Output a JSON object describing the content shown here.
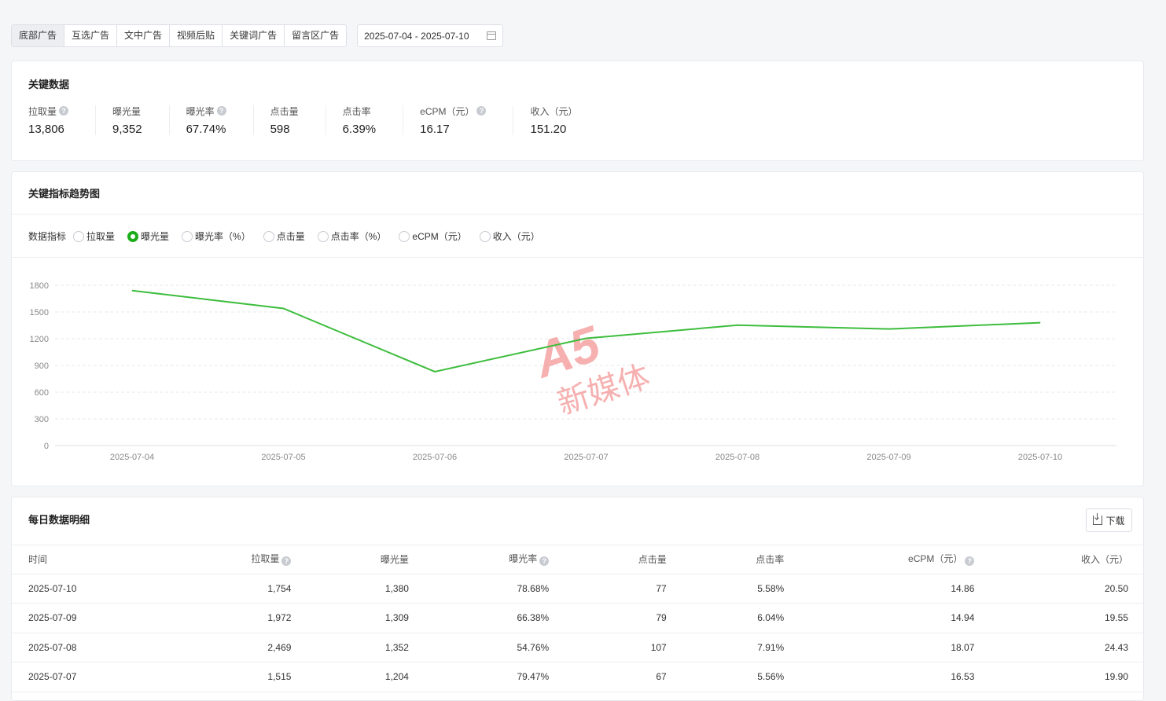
{
  "tabs": [
    {
      "label": "底部广告",
      "active": true
    },
    {
      "label": "互选广告",
      "active": false
    },
    {
      "label": "文中广告",
      "active": false
    },
    {
      "label": "视频后贴",
      "active": false
    },
    {
      "label": "关键词广告",
      "active": false
    },
    {
      "label": "留言区广告",
      "active": false
    }
  ],
  "date_range": "2025-07-04 - 2025-07-10",
  "kpi": {
    "title": "关键数据",
    "items": [
      {
        "label": "拉取量",
        "value": "13,806",
        "help": true
      },
      {
        "label": "曝光量",
        "value": "9,352",
        "help": false
      },
      {
        "label": "曝光率",
        "value": "67.74%",
        "help": true
      },
      {
        "label": "点击量",
        "value": "598",
        "help": false
      },
      {
        "label": "点击率",
        "value": "6.39%",
        "help": false
      },
      {
        "label": "eCPM（元）",
        "value": "16.17",
        "help": true
      },
      {
        "label": "收入（元）",
        "value": "151.20",
        "help": false
      }
    ]
  },
  "trend": {
    "title": "关键指标趋势图",
    "metrics_label": "数据指标",
    "options": [
      {
        "label": "拉取量",
        "checked": false
      },
      {
        "label": "曝光量",
        "checked": true
      },
      {
        "label": "曝光率（%）",
        "checked": false
      },
      {
        "label": "点击量",
        "checked": false
      },
      {
        "label": "点击率（%）",
        "checked": false
      },
      {
        "label": "eCPM（元）",
        "checked": false
      },
      {
        "label": "收入（元）",
        "checked": false
      }
    ],
    "watermark": {
      "logo": "A5",
      "text": "新媒体"
    }
  },
  "chart_data": {
    "type": "line",
    "x": [
      "2025-07-04",
      "2025-07-05",
      "2025-07-06",
      "2025-07-07",
      "2025-07-08",
      "2025-07-09",
      "2025-07-10"
    ],
    "series": [
      {
        "values": [
          1740,
          1540,
          830,
          1204,
          1352,
          1309,
          1380
        ],
        "color": "#3dbd3d"
      }
    ],
    "yticks": [
      0,
      300,
      600,
      900,
      1200,
      1500,
      1800
    ],
    "ylim": [
      0,
      1800
    ],
    "grid": true
  },
  "detail": {
    "title": "每日数据明细",
    "download_label": "下载",
    "columns": [
      {
        "label": "时间",
        "help": false,
        "align": "l"
      },
      {
        "label": "拉取量",
        "help": true,
        "align": "r"
      },
      {
        "label": "曝光量",
        "help": false,
        "align": "r"
      },
      {
        "label": "曝光率",
        "help": true,
        "align": "r"
      },
      {
        "label": "点击量",
        "help": false,
        "align": "r"
      },
      {
        "label": "点击率",
        "help": false,
        "align": "r"
      },
      {
        "label": "eCPM（元）",
        "help": true,
        "align": "r"
      },
      {
        "label": "收入（元）",
        "help": false,
        "align": "r"
      }
    ],
    "rows": [
      [
        "2025-07-10",
        "1,754",
        "1,380",
        "78.68%",
        "77",
        "5.58%",
        "14.86",
        "20.50"
      ],
      [
        "2025-07-09",
        "1,972",
        "1,309",
        "66.38%",
        "79",
        "6.04%",
        "14.94",
        "19.55"
      ],
      [
        "2025-07-08",
        "2,469",
        "1,352",
        "54.76%",
        "107",
        "7.91%",
        "18.07",
        "24.43"
      ],
      [
        "2025-07-07",
        "1,515",
        "1,204",
        "79.47%",
        "67",
        "5.56%",
        "16.53",
        "19.90"
      ]
    ]
  }
}
